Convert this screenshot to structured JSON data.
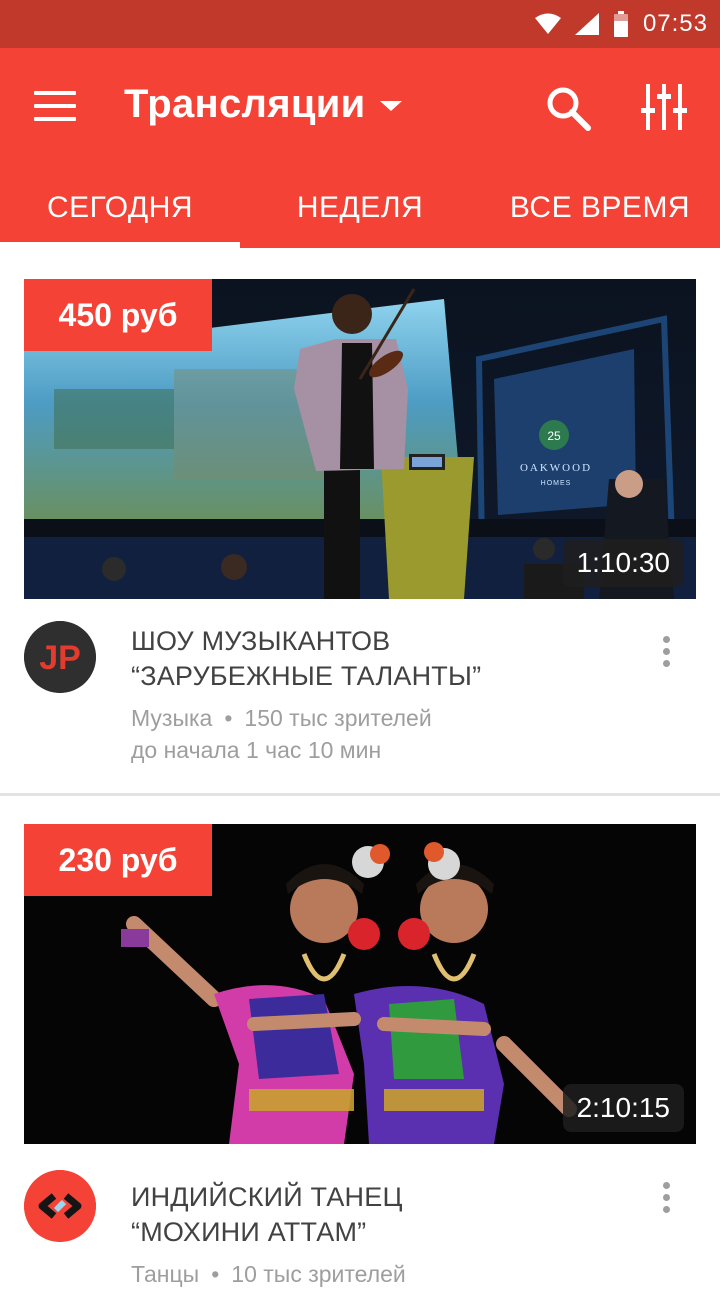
{
  "status_bar": {
    "time": "07:53",
    "icons": [
      "wifi-icon",
      "cell-signal-icon",
      "battery-icon"
    ]
  },
  "app_bar": {
    "title": "Трансляции",
    "icons": [
      "menu-icon",
      "dropdown-caret-icon",
      "search-icon",
      "filter-sliders-icon"
    ]
  },
  "tabs": [
    {
      "label": "СЕГОДНЯ",
      "active": true
    },
    {
      "label": "НЕДЕЛЯ",
      "active": false
    },
    {
      "label": "ВСЕ ВРЕМЯ",
      "active": false
    }
  ],
  "cards": [
    {
      "price": "450 руб",
      "duration": "1:10:30",
      "title_line1": "ШОУ МУЗЫКАНТОВ",
      "title_line2": "“ЗАРУБЕЖНЫЕ ТАЛАНТЫ”",
      "category": "Музыка",
      "viewers": "150 тыс зрителей",
      "starts_in": "до начала 1 час  10 мин",
      "avatar_text": "JP",
      "screen_text": "OAKWOOD",
      "screen_subtext": "HOMES",
      "screen_badge": "25"
    },
    {
      "price": "230 руб",
      "duration": "2:10:15",
      "title_line1": "ИНДИЙСКИЙ ТАНЕЦ",
      "title_line2": "“МОХИНИ АТТАМ”",
      "category": "Танцы",
      "viewers": "10 тыс зрителей"
    }
  ],
  "colors": {
    "primary": "#f44336",
    "status_bar": "#c0392b",
    "text_primary": "#424242",
    "text_secondary": "#9e9e9e"
  }
}
